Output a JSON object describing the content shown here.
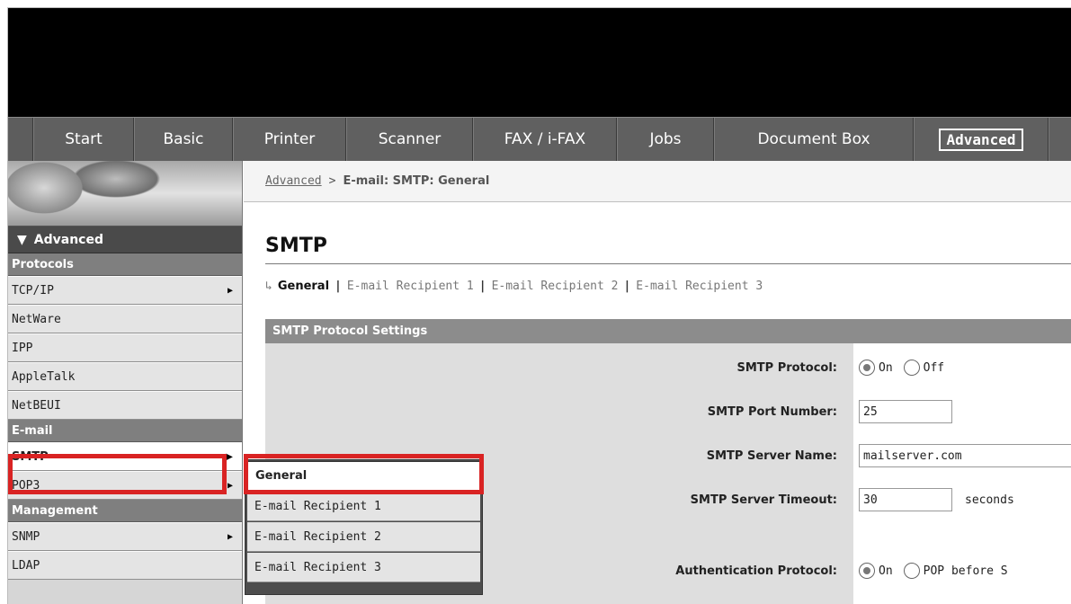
{
  "nav": {
    "tabs": [
      "Start",
      "Basic",
      "Printer",
      "Scanner",
      "FAX / i-FAX",
      "Jobs",
      "Document Box",
      "Advanced"
    ],
    "active": "Advanced"
  },
  "sidebar": {
    "header": "Advanced",
    "groups": {
      "protocols": "Protocols",
      "email": "E-mail",
      "management": "Management"
    },
    "items": {
      "tcpip": "TCP/IP",
      "netware": "NetWare",
      "ipp": "IPP",
      "appletalk": "AppleTalk",
      "netbeui": "NetBEUI",
      "smtp": "SMTP",
      "pop3": "POP3",
      "snmp": "SNMP",
      "ldap": "LDAP"
    }
  },
  "flyout": {
    "items": [
      "General",
      "E-mail Recipient 1",
      "E-mail Recipient 2",
      "E-mail Recipient 3"
    ]
  },
  "breadcrumb": {
    "link": "Advanced",
    "separator": ">",
    "current": "E-mail: SMTP: General"
  },
  "page": {
    "title": "SMTP",
    "subtabs": {
      "arrow": "↳",
      "current": "General",
      "others": [
        "E-mail Recipient 1",
        "E-mail Recipient 2",
        "E-mail Recipient 3"
      ]
    },
    "section": "SMTP Protocol Settings"
  },
  "form": {
    "smtp_protocol": {
      "label": "SMTP Protocol:",
      "options": [
        "On",
        "Off"
      ],
      "selected": "On"
    },
    "port": {
      "label": "SMTP Port Number:",
      "value": "25"
    },
    "server": {
      "label": "SMTP Server Name:",
      "value": "mailserver.com"
    },
    "timeout": {
      "label": "SMTP Server Timeout:",
      "value": "30",
      "unit": "seconds"
    },
    "auth": {
      "label": "Authentication Protocol:",
      "options": [
        "On",
        "POP before S"
      ],
      "selected": "On"
    }
  },
  "colors": {
    "highlight": "#d92323",
    "nav_bg": "#606060",
    "section_bg": "#8c8c8c"
  }
}
